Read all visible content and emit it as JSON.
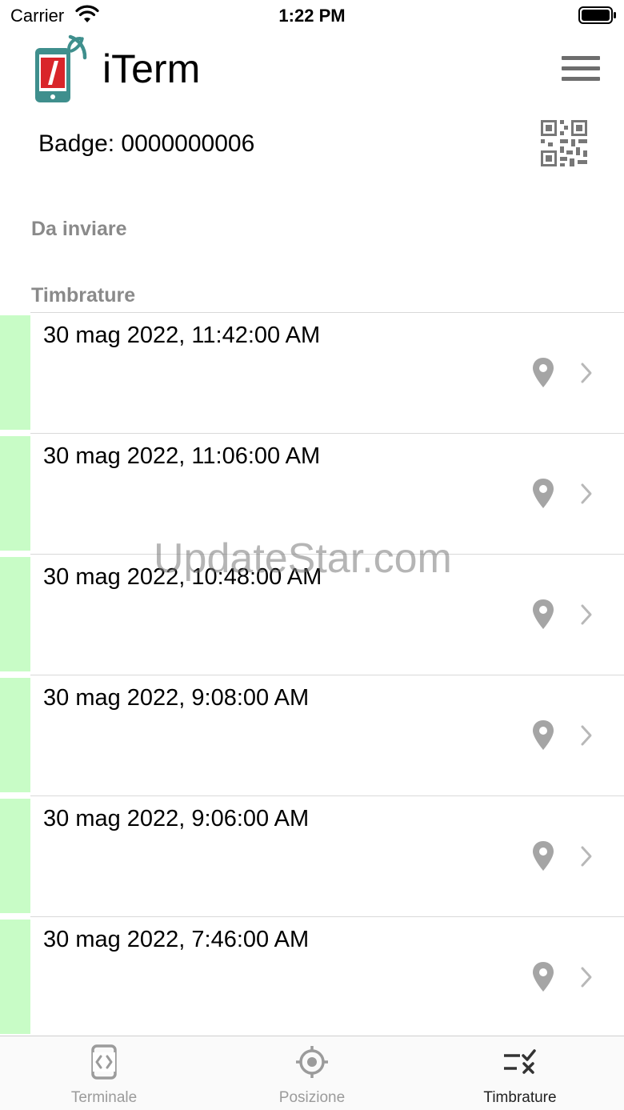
{
  "status_bar": {
    "carrier": "Carrier",
    "time": "1:22 PM"
  },
  "header": {
    "title": "iTerm",
    "badge_label": "Badge: 0000000006"
  },
  "sections": {
    "pending": "Da inviare",
    "records": "Timbrature"
  },
  "records": [
    {
      "time": "30 mag 2022, 11:42:00 AM"
    },
    {
      "time": "30 mag 2022, 11:06:00 AM"
    },
    {
      "time": "30 mag 2022, 10:48:00 AM"
    },
    {
      "time": "30 mag 2022, 9:08:00 AM"
    },
    {
      "time": "30 mag 2022, 9:06:00 AM"
    },
    {
      "time": "30 mag 2022, 7:46:00 AM"
    }
  ],
  "watermark": "UpdateStar.com",
  "tab_bar": {
    "tabs": [
      {
        "label": "Terminale",
        "icon": "phone-code-icon"
      },
      {
        "label": "Posizione",
        "icon": "crosshair-icon"
      },
      {
        "label": "Timbrature",
        "icon": "list-check-icon",
        "active": true
      }
    ]
  },
  "colors": {
    "status_green": "#c8fcc6",
    "icon_gray": "#9b9b9b",
    "logo_teal": "#3f8f8d",
    "logo_red": "#d9252a"
  }
}
